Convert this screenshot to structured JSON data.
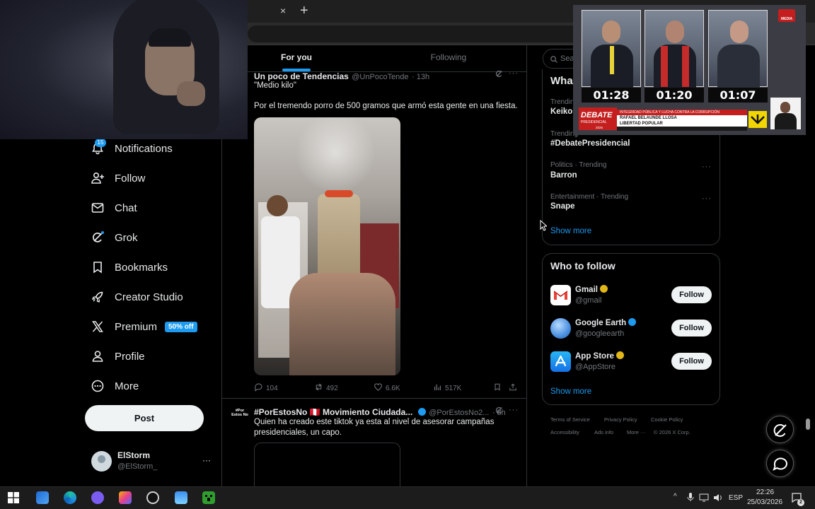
{
  "browser": {
    "tab_close": "×",
    "new_tab": "+"
  },
  "nav": {
    "items": [
      {
        "label": "Notifications",
        "icon": "bell-icon"
      },
      {
        "label": "Follow",
        "icon": "add-person-icon"
      },
      {
        "label": "Chat",
        "icon": "envelope-icon"
      },
      {
        "label": "Grok",
        "icon": "grok-icon"
      },
      {
        "label": "Bookmarks",
        "icon": "bookmark-icon"
      },
      {
        "label": "Creator Studio",
        "icon": "rocket-icon"
      },
      {
        "label": "Premium",
        "icon": "x-logo-icon"
      },
      {
        "label": "Profile",
        "icon": "person-icon"
      },
      {
        "label": "More",
        "icon": "more-circle-icon"
      }
    ],
    "notifications_count": "15",
    "premium_badge": "50% off",
    "post_label": "Post"
  },
  "account": {
    "name": "ElStorm",
    "handle": "@ElStorm_",
    "more": "···"
  },
  "feed": {
    "tabs": {
      "for_you": "For you",
      "following": "Following"
    },
    "tweets": [
      {
        "name": "Un poco de Tendencias",
        "handle": "@UnPocoTende",
        "time": "· 13h",
        "quote": "\"Medio kilo\"",
        "text": "Por el tremendo porro de 500 gramos que armó esta gente en una fiesta.",
        "stats": {
          "replies": "104",
          "reposts": "492",
          "likes": "6.6K",
          "views": "517K"
        }
      },
      {
        "avatar_text": "#Por Estos No",
        "name": "#PorEstosNo 🇵🇪 Movimiento Ciudada...",
        "handle": "@PorEstosNo2...",
        "time": "· 8h",
        "text": "Quien ha creado este tiktok ya esta al nivel de asesorar campañas presidenciales, un capo."
      }
    ]
  },
  "sidebar": {
    "search_placeholder": "Sear",
    "trends_title": "Wha",
    "trends": [
      {
        "meta": "Trending",
        "name": "Keiko"
      },
      {
        "meta": "Trending",
        "name": "#DebatePresidencial"
      },
      {
        "meta": "Politics · Trending",
        "name": "Barron"
      },
      {
        "meta": "Entertainment · Trending",
        "name": "Snape"
      }
    ],
    "show_more": "Show more",
    "who_to_follow": {
      "title": "Who to follow",
      "accounts": [
        {
          "name": "Gmail",
          "handle": "@gmail",
          "verified_color": "#e2b719",
          "button": "Follow"
        },
        {
          "name": "Google Earth",
          "handle": "@googleearth",
          "verified_color": "#1d9bf0",
          "button": "Follow"
        },
        {
          "name": "App Store",
          "handle": "@AppStore",
          "verified_color": "#e2b719",
          "button": "Follow"
        }
      ],
      "show_more": "Show more"
    },
    "footer": {
      "links": [
        "Terms of Service",
        "Privacy Policy",
        "Cookie Policy",
        "Accessibility",
        "Ads info",
        "More ···"
      ],
      "copyright": "© 2026 X Corp."
    }
  },
  "overlay": {
    "timers": [
      "01:28",
      "01:20",
      "01:07"
    ],
    "logo_line1": "DEBATE",
    "logo_line2": "PRESIDENCIAL",
    "logo_year": "2026",
    "banner_top": "INTEGRIDAD PÚBLICA Y LUCHA CONTRA LA CORRUPCIÓN",
    "banner_name": "RAFAEL BELAUNDE LLOSA",
    "banner_party": "LIBERTAD POPULAR",
    "channel_label": "MEDIA"
  },
  "taskbar": {
    "lang": "ESP",
    "time": "22:26",
    "date": "25/03/2026",
    "notif_count": "2"
  },
  "colors": {
    "accent": "#1d9bf0",
    "background": "#000000",
    "text": "#e7e9ea",
    "muted": "#71767b"
  }
}
